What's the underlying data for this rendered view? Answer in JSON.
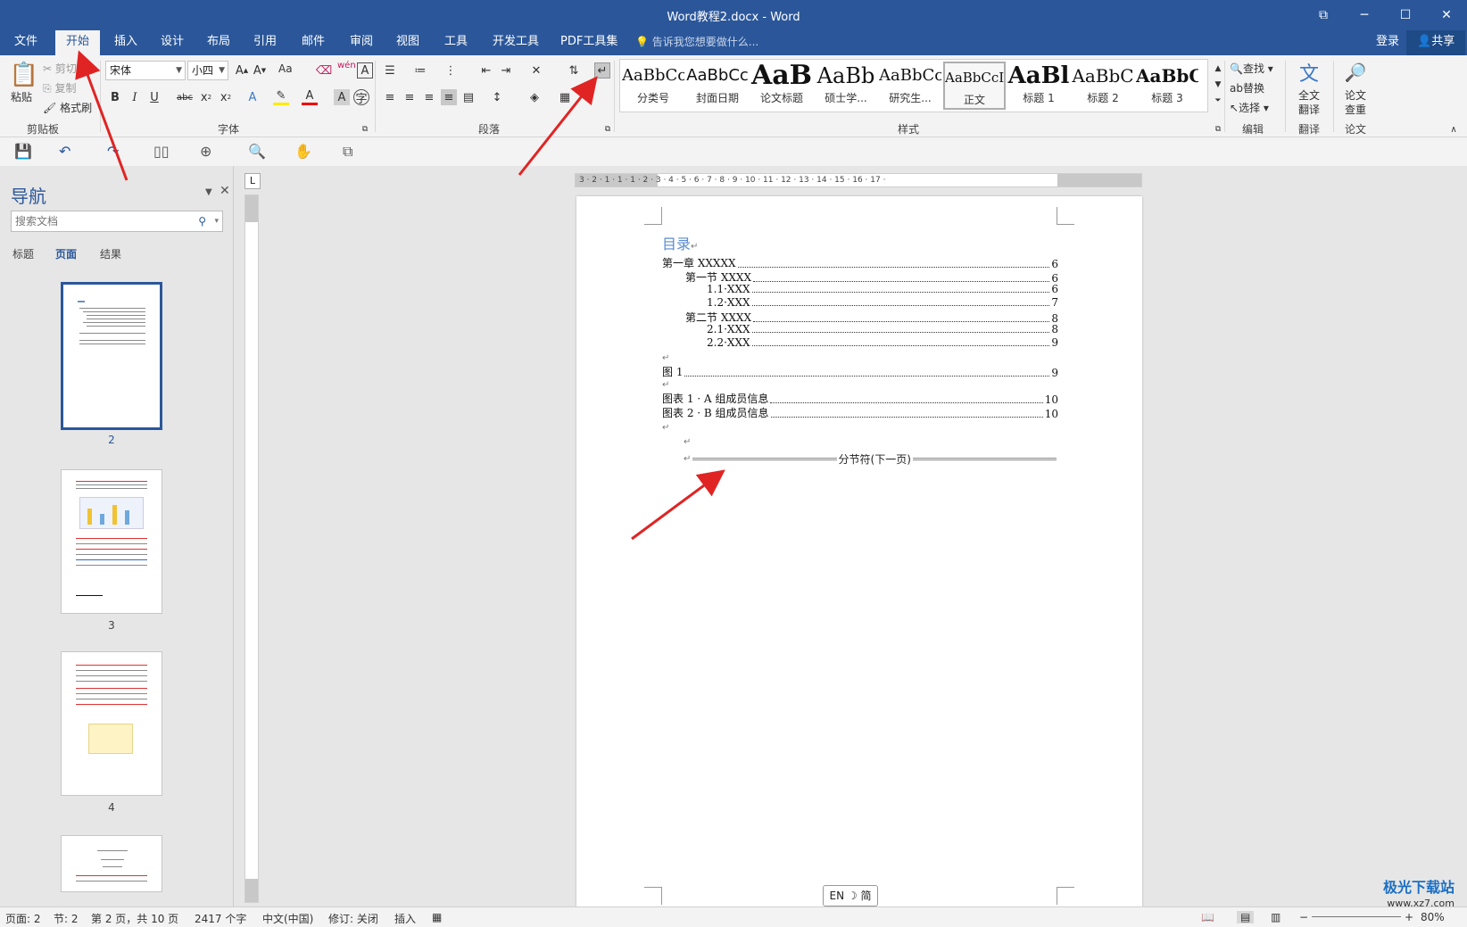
{
  "window": {
    "title": "Word教程2.docx - Word"
  },
  "tabs": [
    "文件",
    "开始",
    "插入",
    "设计",
    "布局",
    "引用",
    "邮件",
    "审阅",
    "视图",
    "工具",
    "开发工具",
    "PDF工具集"
  ],
  "active_tab": "开始",
  "tell_me": "告诉我您想要做什么...",
  "account": {
    "login": "登录",
    "share": "共享"
  },
  "ribbon": {
    "clipboard": {
      "label": "剪贴板",
      "paste": "粘贴",
      "cut": "剪切",
      "copy": "复制",
      "format_painter": "格式刷"
    },
    "font": {
      "label": "字体",
      "font_name": "宋体",
      "font_size": "小四",
      "change_case": "Aa",
      "phonetic": "wén"
    },
    "paragraph": {
      "label": "段落"
    },
    "styles": {
      "label": "样式",
      "items": [
        {
          "preview": "AaBbCc",
          "name": "分类号"
        },
        {
          "preview": "AaBbCc",
          "name": "封面日期"
        },
        {
          "preview": "AaB",
          "name": "论文标题"
        },
        {
          "preview": "AaBb",
          "name": "硕士学..."
        },
        {
          "preview": "AaBbCc",
          "name": "研究生..."
        },
        {
          "preview": "AaBbCcI",
          "name": "正文"
        },
        {
          "preview": "AaBl",
          "name": "标题 1"
        },
        {
          "preview": "AaBbC",
          "name": "标题 2"
        },
        {
          "preview": "AaBbC",
          "name": "标题 3"
        }
      ],
      "selected": "正文"
    },
    "editing": {
      "label": "编辑",
      "find": "查找",
      "replace": "替换",
      "select": "选择"
    },
    "translate": {
      "label": "翻译",
      "full_text": "全文",
      "translate_line": "翻译"
    },
    "paper": {
      "label": "论文",
      "check": "论文",
      "check_line": "查重"
    }
  },
  "nav_pane": {
    "title": "导航",
    "search_placeholder": "搜索文档",
    "tabs": [
      "标题",
      "页面",
      "结果"
    ],
    "active_tab": "页面",
    "pages": [
      "2",
      "3",
      "4"
    ]
  },
  "ruler": {
    "h_ticks": "3 · 2 · 1 · 1 · 1 · 2 · 3 · 4 · 5 · 6 · 7 · 8 · 9 · 10 · 11 · 12 · 13 · 14 · 15 · 16 · 17 ·",
    "tab_stop": "L"
  },
  "document": {
    "toc_title": "目录",
    "toc": [
      {
        "text": "第一章 XXXXX",
        "page": "6",
        "level": 0
      },
      {
        "text": "第一节 XXXX",
        "page": "6",
        "level": 1
      },
      {
        "text": "1.1·XXX",
        "page": "6",
        "level": 2
      },
      {
        "text": "1.2·XXX",
        "page": "7",
        "level": 2
      },
      {
        "text": "第二节 XXXX",
        "page": "8",
        "level": 1
      },
      {
        "text": "2.1·XXX",
        "page": "8",
        "level": 2
      },
      {
        "text": "2.2·XXX",
        "page": "9",
        "level": 2
      }
    ],
    "figures": [
      {
        "text": "图 1",
        "page": "9"
      }
    ],
    "tables": [
      {
        "text": "图表 1 · A 组成员信息",
        "page": "10"
      },
      {
        "text": "图表 2 · B 组成员信息",
        "page": "10"
      }
    ],
    "section_break": "分节符(下一页)"
  },
  "ime": "EN ☽ 简",
  "status": {
    "page": "页面: 2",
    "section": "节: 2",
    "page_of": "第 2 页，共 10 页",
    "words": "2417 个字",
    "lang": "中文(中国)",
    "revision": "修订: 关闭",
    "insert": "插入",
    "zoom": "80%"
  },
  "watermark": {
    "name": "极光下载站",
    "url": "www.xz7.com"
  },
  "colors": {
    "brand": "#2b579a",
    "arrow": "#e02424"
  }
}
